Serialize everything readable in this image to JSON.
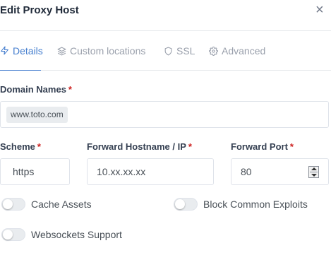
{
  "modal": {
    "title": "Edit Proxy Host",
    "close_label": "×"
  },
  "tabs": [
    {
      "label": "Details",
      "icon": "zap-icon",
      "active": true
    },
    {
      "label": "Custom locations",
      "icon": "layers-icon",
      "active": false
    },
    {
      "label": "SSL",
      "icon": "shield-icon",
      "active": false
    },
    {
      "label": "Advanced",
      "icon": "gear-icon",
      "active": false
    }
  ],
  "form": {
    "required_marker": "*",
    "domain_names": {
      "label": "Domain Names",
      "values": [
        "www.toto.com"
      ]
    },
    "scheme": {
      "label": "Scheme",
      "value": "https"
    },
    "forward_host": {
      "label": "Forward Hostname / IP",
      "value": "10.xx.xx.xx"
    },
    "forward_port": {
      "label": "Forward Port",
      "value": "80"
    },
    "toggles": {
      "cache_assets": {
        "label": "Cache Assets",
        "on": false
      },
      "block_exploits": {
        "label": "Block Common Exploits",
        "on": false
      },
      "websockets": {
        "label": "Websockets Support",
        "on": false
      }
    }
  },
  "colors": {
    "accent": "#467fcf",
    "required": "#cd201f",
    "muted": "#9aa0ac"
  }
}
